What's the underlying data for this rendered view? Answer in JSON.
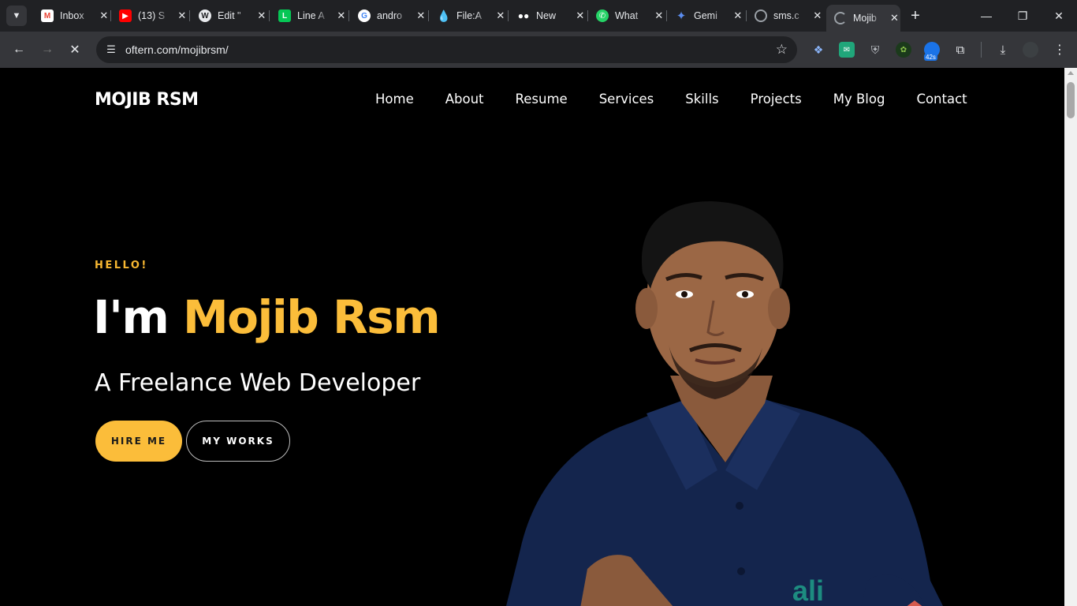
{
  "browser": {
    "tabs": [
      {
        "title": "Inbox",
        "icon": "gmail-icon",
        "color": "#ea4335"
      },
      {
        "title": "(13) S",
        "icon": "youtube-icon",
        "color": "#ff0000"
      },
      {
        "title": "Edit \"",
        "icon": "wordpress-icon",
        "color": "#e8eaed"
      },
      {
        "title": "Line A",
        "icon": "line-icon",
        "color": "#06c755"
      },
      {
        "title": "andro",
        "icon": "google-icon",
        "color": "#4285f4"
      },
      {
        "title": "File:A",
        "icon": "drop-icon",
        "color": "#1a73e8"
      },
      {
        "title": "New",
        "icon": "medium-icon",
        "color": "#ffffff"
      },
      {
        "title": "What",
        "icon": "whatsapp-icon",
        "color": "#25d366"
      },
      {
        "title": "Gemi",
        "icon": "gemini-icon",
        "color": "#5b8def"
      },
      {
        "title": "sms.c",
        "icon": "globe-icon",
        "color": "#9aa0a6"
      },
      {
        "title": "Mojib",
        "icon": "loading-icon",
        "color": "#9aa0a6"
      }
    ],
    "url": "oftern.com/mojibrsm/",
    "extension_badge": "42s"
  },
  "site": {
    "logo": "MOJIB RSM",
    "nav": [
      "Home",
      "About",
      "Resume",
      "Services",
      "Skills",
      "Projects",
      "My Blog",
      "Contact"
    ],
    "hero": {
      "kicker": "HELLO!",
      "headline_prefix": "I'm ",
      "headline_name": "Mojib Rsm",
      "subtitle": "A Freelance Web Developer",
      "primary_button": "HIRE ME",
      "secondary_button": "MY WORKS"
    },
    "shirt_logo_text": "ali",
    "colors": {
      "accent": "#fbbd3a",
      "background": "#000000",
      "shirt": "#14254d"
    }
  }
}
